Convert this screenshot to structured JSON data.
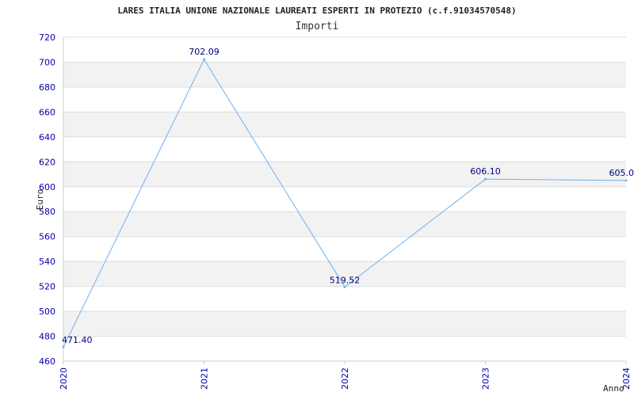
{
  "chart_data": {
    "type": "line",
    "title": "LARES ITALIA UNIONE NAZIONALE LAUREATI ESPERTI IN PROTEZIO (c.f.91034570548)",
    "subtitle": "Importi",
    "xlabel": "Anno",
    "ylabel": "Euro",
    "x": [
      "2020",
      "2021",
      "2022",
      "2023",
      "2024"
    ],
    "series": [
      {
        "values": [
          471.4,
          702.09,
          519.52,
          606.1,
          605.0
        ],
        "labels": [
          "471.40",
          "702.09",
          "519.52",
          "606.10",
          "605.0"
        ]
      }
    ],
    "ylim": [
      460,
      720
    ],
    "yticks": [
      460,
      480,
      500,
      520,
      540,
      560,
      580,
      600,
      620,
      640,
      660,
      680,
      700,
      720
    ],
    "grid": true,
    "colors": {
      "line": "#6fb1f0",
      "band": "#f2f2f2",
      "gridline": "#dddddd",
      "tick": "#0000aa"
    }
  }
}
